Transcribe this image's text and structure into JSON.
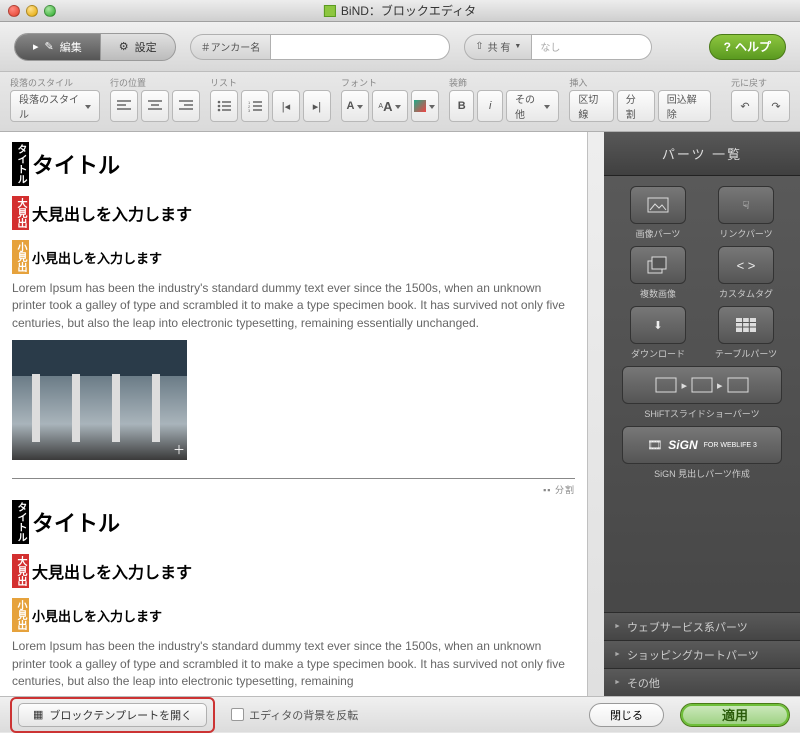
{
  "window": {
    "title": "BiND：ブロックエディタ"
  },
  "toolbar1": {
    "edit": "編集",
    "settings": "設定",
    "anchor_label": "＃アンカー名",
    "anchor_value": "",
    "share_label": "共 有",
    "share_value": "なし",
    "help": "ヘルプ"
  },
  "toolbar2": {
    "groups": {
      "para_style": "段落のスタイル",
      "align": "行の位置",
      "list": "リスト",
      "font": "フォント",
      "decor": "装飾",
      "insert": "挿入",
      "undo": "元に戻す"
    },
    "para_style_btn": "段落のスタイル",
    "other_btn": "その他",
    "insert_sep": "区切線",
    "insert_split": "分 割",
    "insert_unwrap": "回込解除"
  },
  "content": {
    "title_tag": "タイトル",
    "title_text": "タイトル",
    "big_tag": "大見出",
    "big_text": "大見出しを入力します",
    "small_tag": "小見出",
    "small_text": "小見出しを入力します",
    "para": "Lorem Ipsum has been the industry's standard dummy text ever since the 1500s, when an unknown printer took a galley of type and scrambled it to make a type specimen book. It has survived not only five centuries, but also the leap into electronic typesetting, remaining essentially unchanged.",
    "divider": "分割",
    "para2": "Lorem Ipsum has been the industry's standard dummy text ever since the 1500s, when an unknown printer took a galley of type and scrambled it to make a type specimen book. It has survived not only five centuries, but also the leap into electronic typesetting, remaining"
  },
  "sidebar": {
    "header": "パーツ 一覧",
    "parts": {
      "image": "画像パーツ",
      "link": "リンクパーツ",
      "multi": "複数画像",
      "custom": "カスタムタグ",
      "download": "ダウンロード",
      "table": "テーブルパーツ",
      "shift": "SHiFTスライドショーパーツ",
      "sign": "SiGN 見出しパーツ作成",
      "sign_btn": "SiGN",
      "sign_sub": "FOR WEBLIFE 3"
    },
    "accordion": {
      "web": "ウェブサービス系パーツ",
      "cart": "ショッピングカートパーツ",
      "other": "その他"
    }
  },
  "bottom": {
    "template": "ブロックテンプレートを開く",
    "invert": "エディタの背景を反転",
    "close": "閉じる",
    "apply": "適用"
  }
}
